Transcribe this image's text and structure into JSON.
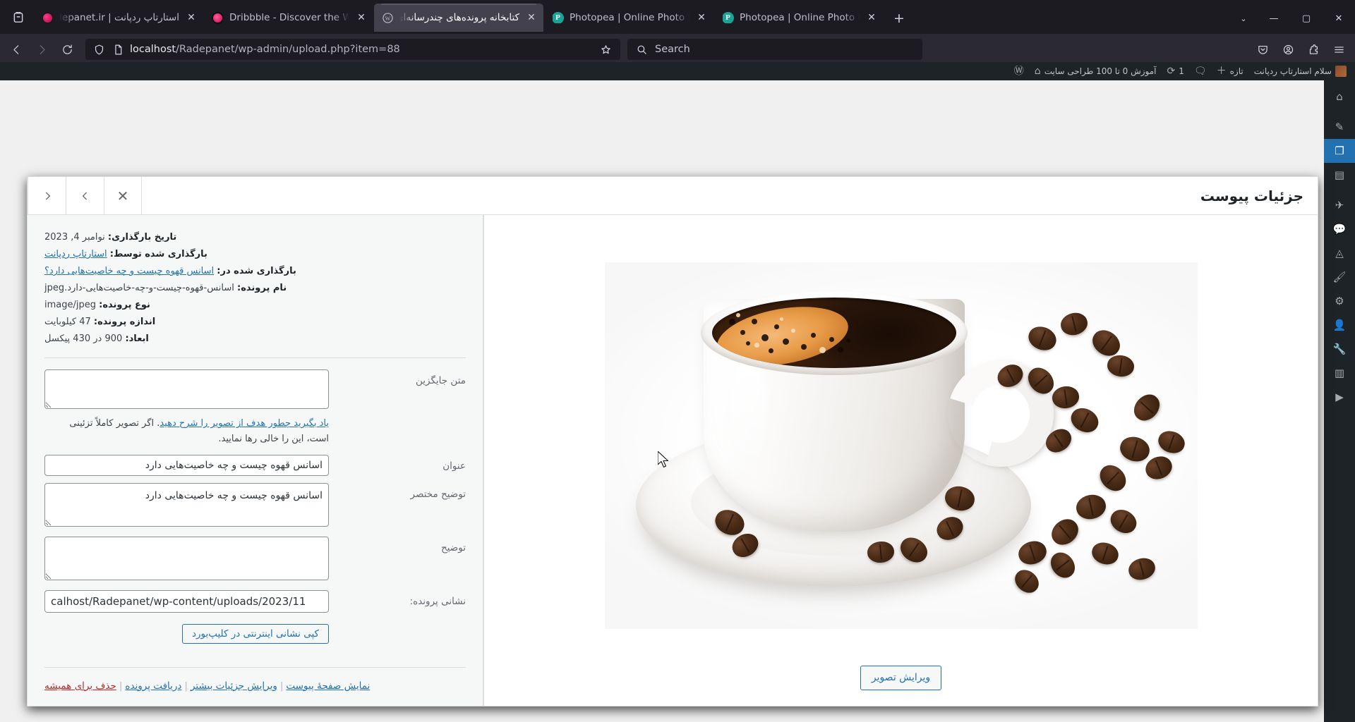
{
  "browser": {
    "tabs": [
      {
        "title": "استارتاپ ردپانت | Radepanet.ir",
        "favicon": "radepanet-favicon",
        "rtl": true,
        "active": false
      },
      {
        "title": "Dribbble - Discover the World",
        "favicon": "dribbble-favicon",
        "rtl": false,
        "active": false
      },
      {
        "title": "کتابخانه پرونده‌های چندرسانه‌ای د آم",
        "favicon": "wordpress-favicon",
        "rtl": true,
        "active": true
      },
      {
        "title": "Photopea | Online Photo Editor",
        "favicon": "photopea-favicon",
        "rtl": false,
        "active": false
      },
      {
        "title": "Photopea | Online Photo Editor",
        "favicon": "photopea-favicon",
        "rtl": false,
        "active": false
      }
    ],
    "close_glyph": "✕",
    "newtab_glyph": "+",
    "firefox_view_label": "firefox-view",
    "window": {
      "list": "⌄",
      "minimize": "—",
      "maximize": "▢",
      "close": "✕"
    },
    "url": {
      "prefix": "localhost",
      "rest": "/Radepanet/wp-admin/upload.php?item=88"
    },
    "search_placeholder": "Search",
    "icons": {
      "back": "back-arrow",
      "forward": "forward-arrow",
      "reload": "reload",
      "shield": "shield",
      "page": "page",
      "star": "star",
      "pocket": "pocket",
      "account": "account",
      "extensions": "extensions",
      "menu": "menu"
    }
  },
  "adminbar": {
    "wp_logo": "wordpress-logo",
    "home_icon": "home-icon",
    "site_name": "آموزش 0 تا 100 طراحی سایت",
    "updates_count": "1",
    "comments_count": "",
    "new_label": "تازه",
    "greeting": "سلام استارتاپ ردپانت"
  },
  "wp_sidebar": {
    "items": [
      {
        "name": "dashboard",
        "glyph": "⌂"
      },
      {
        "name": "posts",
        "glyph": "✎"
      },
      {
        "name": "media",
        "glyph": "❐",
        "current": true
      },
      {
        "name": "pages",
        "glyph": "▤"
      },
      {
        "name": "comments",
        "glyph": "💬"
      },
      {
        "name": "elementor",
        "glyph": "◬"
      },
      {
        "name": "templates",
        "glyph": "✈"
      },
      {
        "name": "appearance",
        "glyph": "🖌"
      },
      {
        "name": "plugins",
        "glyph": "⚙"
      },
      {
        "name": "users",
        "glyph": "👤"
      },
      {
        "name": "tools",
        "glyph": "🔧"
      },
      {
        "name": "settings",
        "glyph": "▥"
      },
      {
        "name": "media-player",
        "glyph": "▶"
      }
    ]
  },
  "modal": {
    "title": "جزئیات پیوست",
    "close_glyph": "✕",
    "prev_label": "prev",
    "next_label": "next",
    "edit_image_button": "ویرایش تصویر"
  },
  "details": {
    "upload_date_label": "تاریخ بارگذاری:",
    "upload_date_value": "نوامبر 4, 2023",
    "uploaded_by_label": "بارگذاری شده توسط:",
    "uploaded_by_value": "استارتاپ ردپانت",
    "uploaded_to_label": "بارگذاری شده در:",
    "uploaded_to_value": "اسانس قهوه چیست و چه خاصیت‌هایی دارد؟",
    "file_name_label": "نام پرونده:",
    "file_name_value": "اسانس-قهوه-چیست-و-چه-خاصیت‌هایی-دارد.jpeg",
    "file_type_label": "نوع پرونده:",
    "file_type_value": "image/jpeg",
    "file_size_label": "اندازه پرونده:",
    "file_size_value": "47 کیلوبایت",
    "dimensions_label": "ابعاد:",
    "dimensions_value": "900 در 430 پیکسل"
  },
  "fields": {
    "alt_label": "متن جایگزین",
    "alt_value": "",
    "alt_help_link": "یاد بگیرید چطور هدف از تصویر را شرح دهید",
    "alt_help_rest": ". اگر تصویر کاملاً تزئینی است، این را خالی رها نمایید.",
    "title_label": "عنوان",
    "title_value": "اسانس قهوه چیست و چه خاصیت‌هایی دارد",
    "caption_label": "توضیح مختصر",
    "caption_value": "اسانس قهوه چیست و چه خاصیت‌هایی دارد",
    "description_label": "توضیح",
    "description_value": "",
    "file_url_label": "نشانی پرونده:",
    "file_url_value": "calhost/Radepanet/wp-content/uploads/2023/11",
    "copy_url_button": "کپی نشانی اینترنتی در کلیپ‌بورد"
  },
  "actions": {
    "view_page": "نمایش صفحهٔ پیوست",
    "edit_more": "ویرایش جزئیات بیشتر",
    "download": "دریافت پرونده",
    "delete": "حذف برای همیشه",
    "separator": "|"
  },
  "image": {
    "alt": "فنجان قهوه سفید با دانه‌های قهوه",
    "subject": "coffee-cup-with-beans"
  },
  "colors": {
    "accent": "#2271b1",
    "danger": "#b32d2e",
    "admin_bg": "#1d2327",
    "browser_chrome": "#2b2a33",
    "tab_active": "#42414d"
  }
}
